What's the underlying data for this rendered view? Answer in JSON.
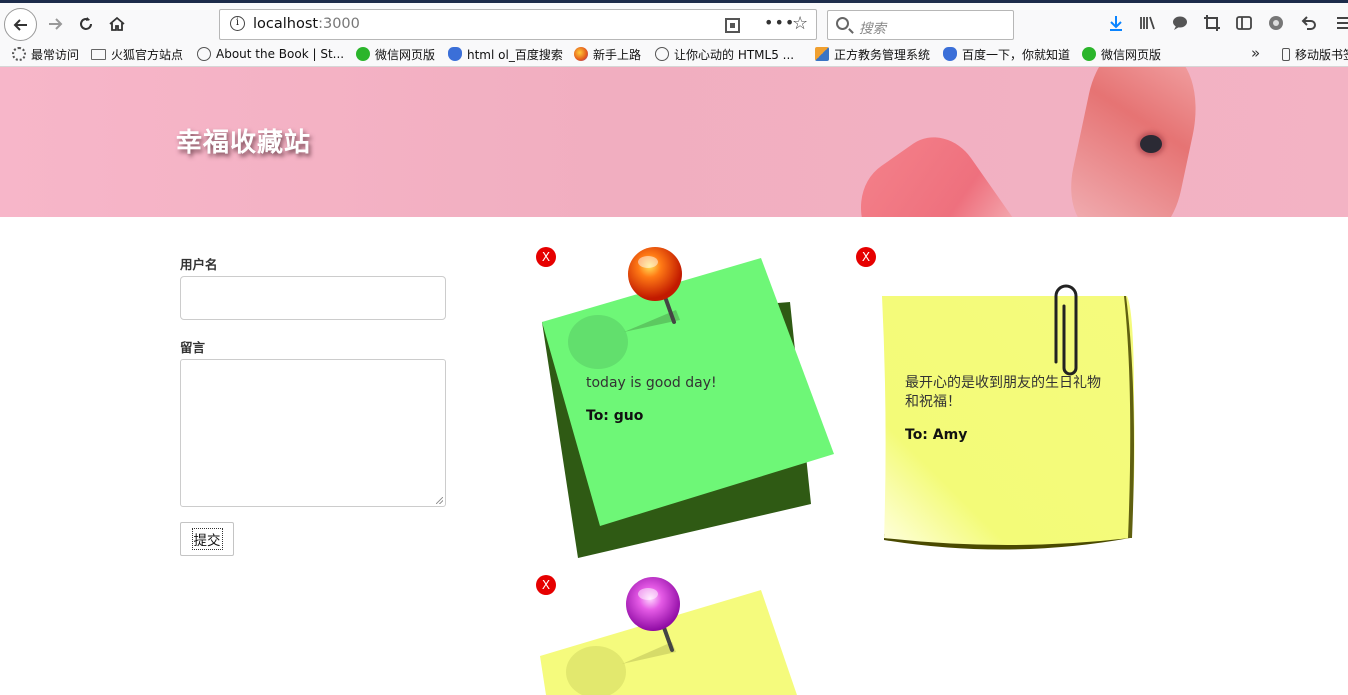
{
  "browser": {
    "url_host": "localhost",
    "url_port": ":3000",
    "search_placeholder": "搜索",
    "bookmarks": [
      {
        "label": "最常访问",
        "icon": "gear-icon"
      },
      {
        "label": "火狐官方站点",
        "icon": "folder-icon"
      },
      {
        "label": "About the Book | St...",
        "icon": "globe-icon"
      },
      {
        "label": "微信网页版",
        "icon": "wechat-icon"
      },
      {
        "label": "html ol_百度搜索",
        "icon": "baidu-icon"
      },
      {
        "label": "新手上路",
        "icon": "firefox-icon"
      },
      {
        "label": "让你心动的 HTML5 ...",
        "icon": "globe-icon"
      },
      {
        "label": "正方教务管理系统",
        "icon": "cube-icon"
      },
      {
        "label": "百度一下，你就知道",
        "icon": "baidu-icon"
      },
      {
        "label": "微信网页版",
        "icon": "wechat-icon"
      }
    ],
    "mobile_bookmarks": "移动版书签"
  },
  "banner": {
    "title": "幸福收藏站"
  },
  "form": {
    "username_label": "用户名",
    "username_value": "",
    "message_label": "留言",
    "message_value": "",
    "submit_label": "提交"
  },
  "notes": [
    {
      "text": "today is good day!",
      "to": "To: guo",
      "close": "X",
      "color": "#6ef777",
      "pin": "red-pushpin"
    },
    {
      "text": "最开心的是收到朋友的生日礼物和祝福！",
      "to": "To: Amy",
      "close": "X",
      "color": "#f5fb7d",
      "pin": "paperclip"
    },
    {
      "text": "",
      "to": "",
      "close": "X",
      "color": "#f5fb7d",
      "pin": "purple-pushpin"
    }
  ]
}
